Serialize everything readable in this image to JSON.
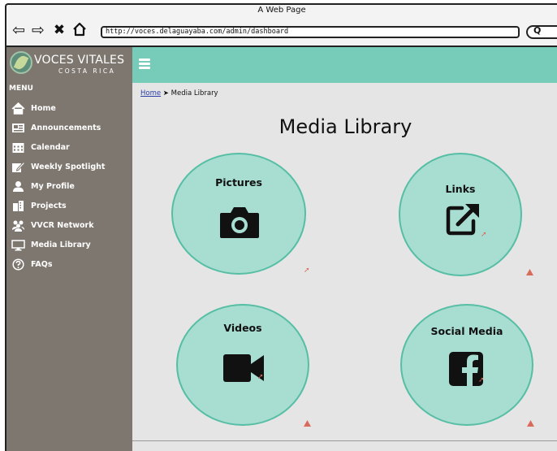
{
  "browser": {
    "title": "A Web Page",
    "url": "http://voces.delaguayaba.com/admin/dashboard",
    "nav_icons": [
      "back-icon",
      "forward-icon",
      "close-icon",
      "home-icon"
    ]
  },
  "brand": {
    "name": "VOCES VITALES",
    "subtitle": "COSTA RICA"
  },
  "sidebar": {
    "menu_label": "MENU",
    "items": [
      {
        "label": "Home",
        "icon": "home-icon"
      },
      {
        "label": "Announcements",
        "icon": "newspaper-icon"
      },
      {
        "label": "Calendar",
        "icon": "calendar-icon"
      },
      {
        "label": "Weekly Spotlight",
        "icon": "edit-icon"
      },
      {
        "label": "My Profile",
        "icon": "user-icon"
      },
      {
        "label": "Projects",
        "icon": "building-icon"
      },
      {
        "label": "VVCR Network",
        "icon": "network-icon"
      },
      {
        "label": "Media Library",
        "icon": "monitor-icon"
      },
      {
        "label": "FAQs",
        "icon": "question-icon"
      }
    ]
  },
  "breadcrumb": {
    "home": "Home",
    "current": "Media Library"
  },
  "page": {
    "title": "Media Library"
  },
  "tiles": [
    {
      "label": "Pictures",
      "icon": "camera-icon"
    },
    {
      "label": "Links",
      "icon": "external-link-icon"
    },
    {
      "label": "Videos",
      "icon": "video-camera-icon"
    },
    {
      "label": "Social Media",
      "icon": "facebook-icon"
    }
  ],
  "colors": {
    "header_accent": "#76ccb9",
    "tile_fill": "#a8ddd1",
    "tile_border": "#55bea4",
    "sidebar_bg": "#7e776f",
    "content_bg": "#e5e5e5",
    "link": "#2a3ea8",
    "warning": "#d96b5c"
  }
}
